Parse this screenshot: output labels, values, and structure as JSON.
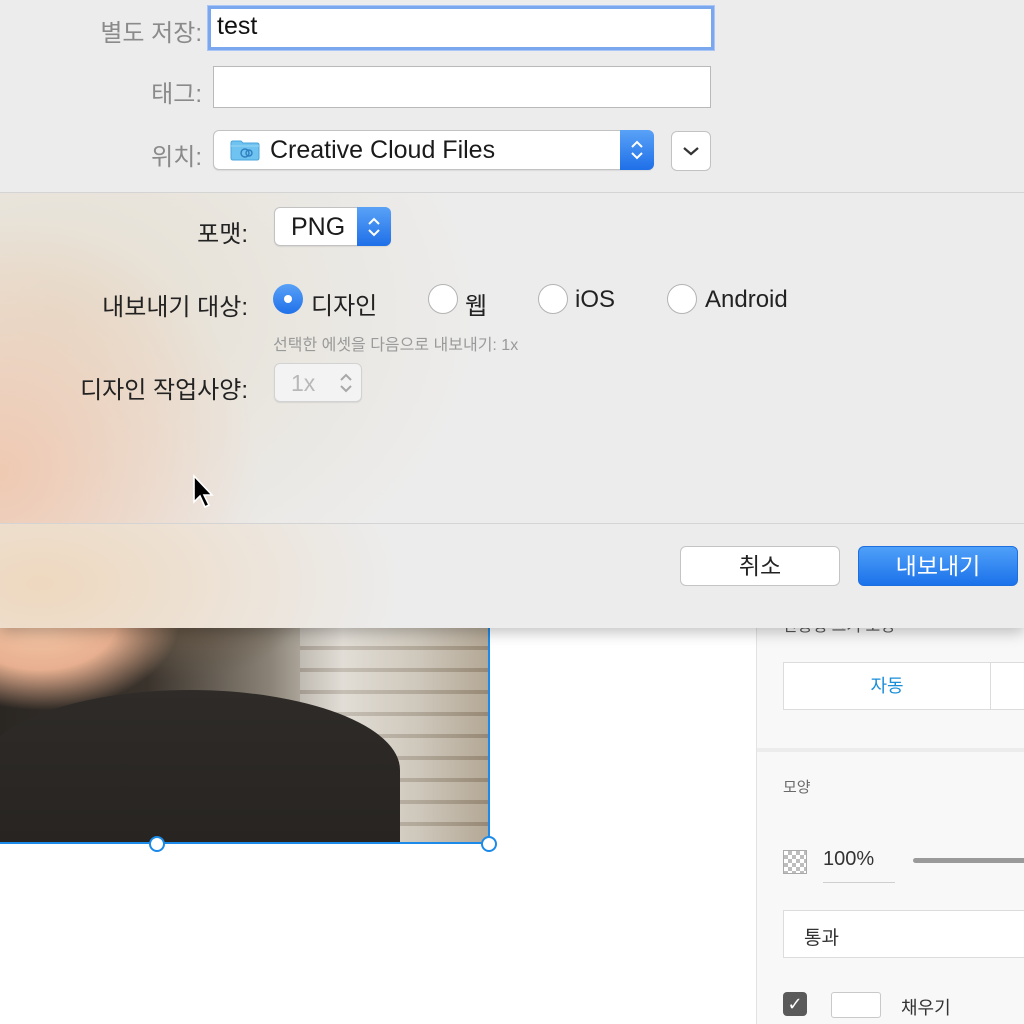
{
  "dialog": {
    "save_as_label": "별도 저장:",
    "save_as_value": "test",
    "tags_label": "태그:",
    "tags_value": "",
    "location_label": "위치:",
    "location_value": "Creative Cloud Files",
    "format_label": "포맷:",
    "format_value": "PNG",
    "export_for_label": "내보내기 대상:",
    "export_targets": [
      {
        "label": "디자인",
        "selected": true
      },
      {
        "label": "웹",
        "selected": false
      },
      {
        "label": "iOS",
        "selected": false
      },
      {
        "label": "Android",
        "selected": false
      }
    ],
    "hint": "선택한 에셋을 다음으로 내보내기: 1x",
    "design_spec_label": "디자인 작업사양:",
    "design_spec_value": "1x",
    "cancel_label": "취소",
    "export_label": "내보내기",
    "accent_color": "#1f6fe8"
  },
  "inspector": {
    "responsive_caption": "반응형 크기 조정",
    "auto_label": "자동",
    "appearance_title": "모양",
    "opacity": "100%",
    "blend_mode": "통과",
    "fill_label": "채우기",
    "fill_checked": true,
    "selection_color": "#1b8ae8"
  }
}
